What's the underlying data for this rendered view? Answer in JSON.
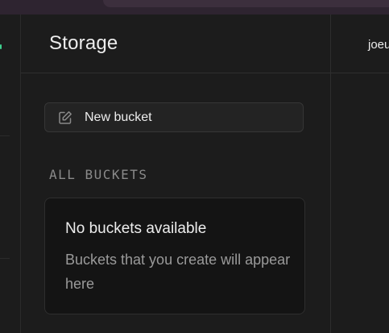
{
  "storage_panel": {
    "title": "Storage",
    "new_bucket_label": "New bucket",
    "new_bucket_icon": "edit-icon",
    "section_label": "ALL BUCKETS",
    "empty_state": {
      "title": "No buckets available",
      "description": "Buckets that you create will appear here"
    }
  },
  "right_header": {
    "user_text": "joeu"
  },
  "colors": {
    "background": "#1c1c1c",
    "accent": "#3ecf8e",
    "text_primary": "#ededed",
    "text_muted": "#9a9a9a"
  }
}
